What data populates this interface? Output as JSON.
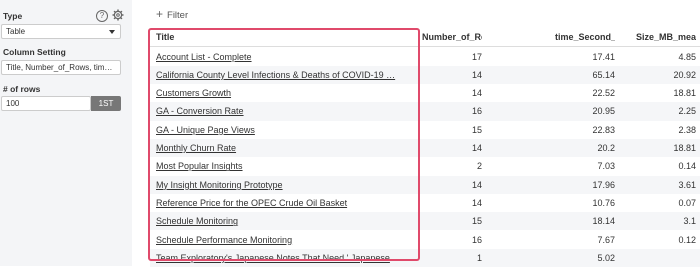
{
  "sidebar": {
    "type_label": "Type",
    "type_value": "Table",
    "column_setting_label": "Column Setting",
    "column_setting_value": "Title, Number_of_Rows, tim…",
    "rows_label": "# of rows",
    "rows_value": "100",
    "first_button": "1ST"
  },
  "filter_label": "Filter",
  "table": {
    "headers": [
      "Title",
      "Number_of_Rows",
      "time_Second_mean",
      "Size_MB_mean"
    ],
    "rows": [
      [
        "Account List - Complete",
        "17",
        "17.41",
        "4.85"
      ],
      [
        "California County Level Infections & Deaths of COVID-19 …",
        "14",
        "65.14",
        "20.92"
      ],
      [
        "Customers Growth",
        "14",
        "22.52",
        "18.81"
      ],
      [
        "GA - Conversion Rate",
        "16",
        "20.95",
        "2.25"
      ],
      [
        "GA - Unique Page Views",
        "15",
        "22.83",
        "2.38"
      ],
      [
        "Monthly Churn Rate",
        "14",
        "20.2",
        "18.81"
      ],
      [
        "Most Popular Insights",
        "2",
        "7.03",
        "0.14"
      ],
      [
        "My Insight Monitoring Prototype",
        "14",
        "17.96",
        "3.61"
      ],
      [
        "Reference Price for the OPEC Crude Oil Basket",
        "14",
        "10.76",
        "0.07"
      ],
      [
        "Schedule Monitoring",
        "15",
        "18.14",
        "3.1"
      ],
      [
        "Schedule Performance Monitoring",
        "16",
        "7.67",
        "0.12"
      ],
      [
        "Team Exploratory's Japanese Notes That Need ' Japanese",
        "1",
        "5.02",
        ""
      ]
    ]
  },
  "icons": {
    "help": "help-icon",
    "settings": "gear-icon",
    "add": "plus-icon",
    "dropdown": "chevron-down-icon"
  },
  "colors": {
    "highlight": "#e04a6b",
    "sidebar_bg": "#f4f5f7",
    "button_bg": "#777777"
  }
}
